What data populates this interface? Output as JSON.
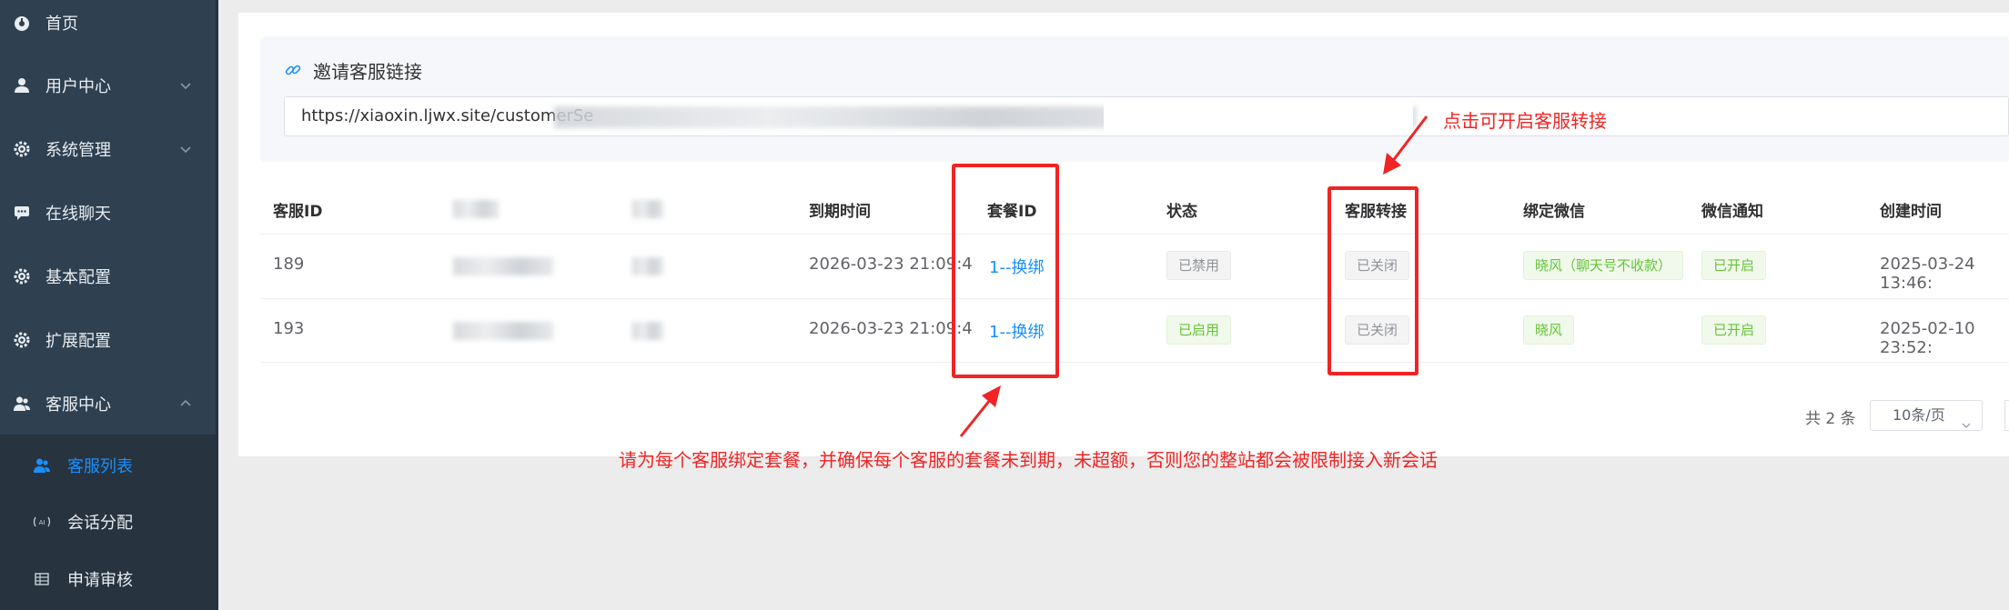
{
  "sidebar": {
    "items": [
      {
        "label": "首页",
        "icon": "dashboard-icon"
      },
      {
        "label": "用户中心",
        "icon": "user-icon"
      },
      {
        "label": "系统管理",
        "icon": "gear-icon"
      },
      {
        "label": "在线聊天",
        "icon": "chat-icon"
      },
      {
        "label": "基本配置",
        "icon": "gear-icon"
      },
      {
        "label": "扩展配置",
        "icon": "gear-icon"
      },
      {
        "label": "客服中心",
        "icon": "users-icon"
      }
    ],
    "subitems": [
      {
        "label": "客服列表",
        "icon": "users-icon",
        "active": true
      },
      {
        "label": "会话分配",
        "icon": "ai-icon"
      },
      {
        "label": "申请审核",
        "icon": "grid-icon"
      }
    ]
  },
  "invite": {
    "title": "邀请客服链接",
    "url": "https://xiaoxin.ljwx.site/customerSe"
  },
  "table": {
    "headers": {
      "id": "客服ID",
      "expire": "到期时间",
      "package": "套餐ID",
      "status": "状态",
      "transfer": "客服转接",
      "wechat": "绑定微信",
      "notify": "微信通知",
      "created": "创建时间"
    },
    "rows": [
      {
        "id": "189",
        "expire": "2026-03-23 21:09:4",
        "package": "1--换绑",
        "status": "已禁用",
        "transfer": "已关闭",
        "wechat": "晓风（聊天号不收款）",
        "notify": "已开启",
        "created": "2025-03-24 13:46:"
      },
      {
        "id": "193",
        "expire": "2026-03-23 21:09:4",
        "package": "1--换绑",
        "status": "已启用",
        "transfer": "已关闭",
        "wechat": "晓风",
        "notify": "已开启",
        "created": "2025-02-10 23:52:"
      }
    ]
  },
  "annotations": {
    "transfer_hint": "点击可开启客服转接",
    "package_hint": "请为每个客服绑定套餐，并确保每个客服的套餐未到期，未超额，否则您的整站都会被限制接入新会话"
  },
  "pager": {
    "total": "共 2 条",
    "page_size": "10条/页"
  },
  "colors": {
    "sidebar": "#2f4050",
    "accent": "#1890ff",
    "annotation": "#f02424",
    "success": "#67c23a"
  }
}
